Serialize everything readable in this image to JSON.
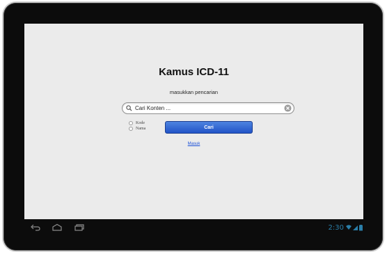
{
  "app": {
    "title": "Kamus ICD-11",
    "subtitle": "masukkan pencarian"
  },
  "search": {
    "placeholder": "Cari Konten ...",
    "value": ""
  },
  "options": [
    {
      "label": "Kode",
      "checked": false
    },
    {
      "label": "Nama",
      "checked": false
    }
  ],
  "buttons": {
    "search_label": "Cari",
    "login_label": "Masuk"
  },
  "status_bar": {
    "time": "2:30",
    "accent_color": "#2a7ea8",
    "icons": [
      "back-icon",
      "home-icon",
      "recent-apps-icon",
      "wifi-icon",
      "signal-icon",
      "battery-icon"
    ]
  },
  "colors": {
    "button_primary": "#2153c7",
    "link": "#1a4fd8",
    "screen_background": "#ebebeb"
  }
}
